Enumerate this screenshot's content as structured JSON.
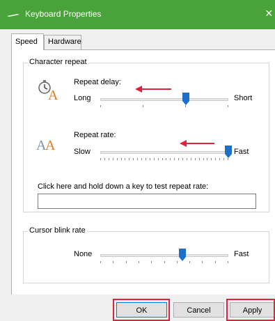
{
  "window": {
    "title": "Keyboard Properties",
    "close_glyph": "×",
    "titlebar_color": "#4aa23b"
  },
  "tabs": [
    {
      "label": "Speed",
      "active": true
    },
    {
      "label": "Hardware",
      "active": false
    }
  ],
  "character_repeat": {
    "legend": "Character repeat",
    "repeat_delay": {
      "label": "Repeat delay:",
      "min_label": "Long",
      "max_label": "Short",
      "icon": "stopwatch-letter-a-icon",
      "value_fraction": 0.67
    },
    "repeat_rate": {
      "label": "Repeat rate:",
      "min_label": "Slow",
      "max_label": "Fast",
      "icon": "double-letter-a-icon",
      "value_fraction": 1.0
    },
    "test_prompt": "Click here and hold down a key to test repeat rate:",
    "test_value": ""
  },
  "cursor_blink": {
    "legend": "Cursor blink rate",
    "min_label": "None",
    "max_label": "Fast",
    "value_fraction": 0.64
  },
  "buttons": {
    "ok": "OK",
    "cancel": "Cancel",
    "apply": "Apply"
  },
  "annotations": {
    "arrow_color": "#e0233a",
    "highlight_color": "#e0233a",
    "slider_thumb_color": "#1e6fc7"
  }
}
